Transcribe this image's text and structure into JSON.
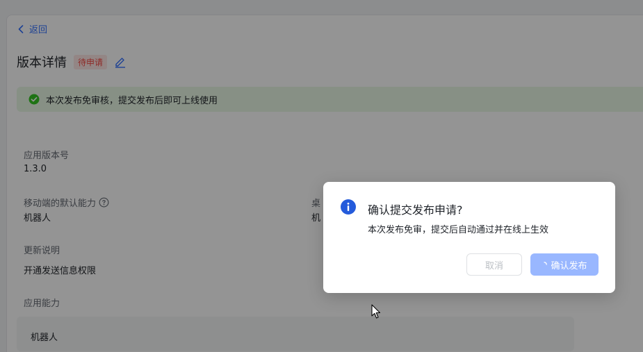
{
  "page": {
    "back_label": "返回",
    "title": "版本详情",
    "status": "待申请",
    "notice": "本次发布免审核，提交发布后即可上线使用",
    "fields": {
      "version_label": "应用版本号",
      "version_value": "1.3.0",
      "mobile_default_label": "移动端的默认能力",
      "mobile_default_value": "机器人",
      "desktop_default_label": "桌",
      "desktop_default_value": "机",
      "update_notes_label": "更新说明",
      "update_notes_value": "开通发送信息权限",
      "capabilities_label": "应用能力",
      "capability_item": "机器人"
    }
  },
  "dialog": {
    "title": "确认提交发布申请?",
    "message": "本次发布免审，提交后自动通过并在线上生效",
    "cancel_label": "取消",
    "confirm_label": "确认发布"
  },
  "colors": {
    "accent": "#3370ff",
    "confirm_disabled": "#99b7ff",
    "status_red": "#f54a45",
    "success_green": "#34c724"
  },
  "icons": {
    "back": "chevron-left-icon",
    "edit": "edit-pencil-icon",
    "notice": "check-circle-icon",
    "help": "question-circle-icon",
    "dialog": "info-circle-icon",
    "loading": "spinner-icon",
    "cursor": "mouse-pointer-icon"
  }
}
